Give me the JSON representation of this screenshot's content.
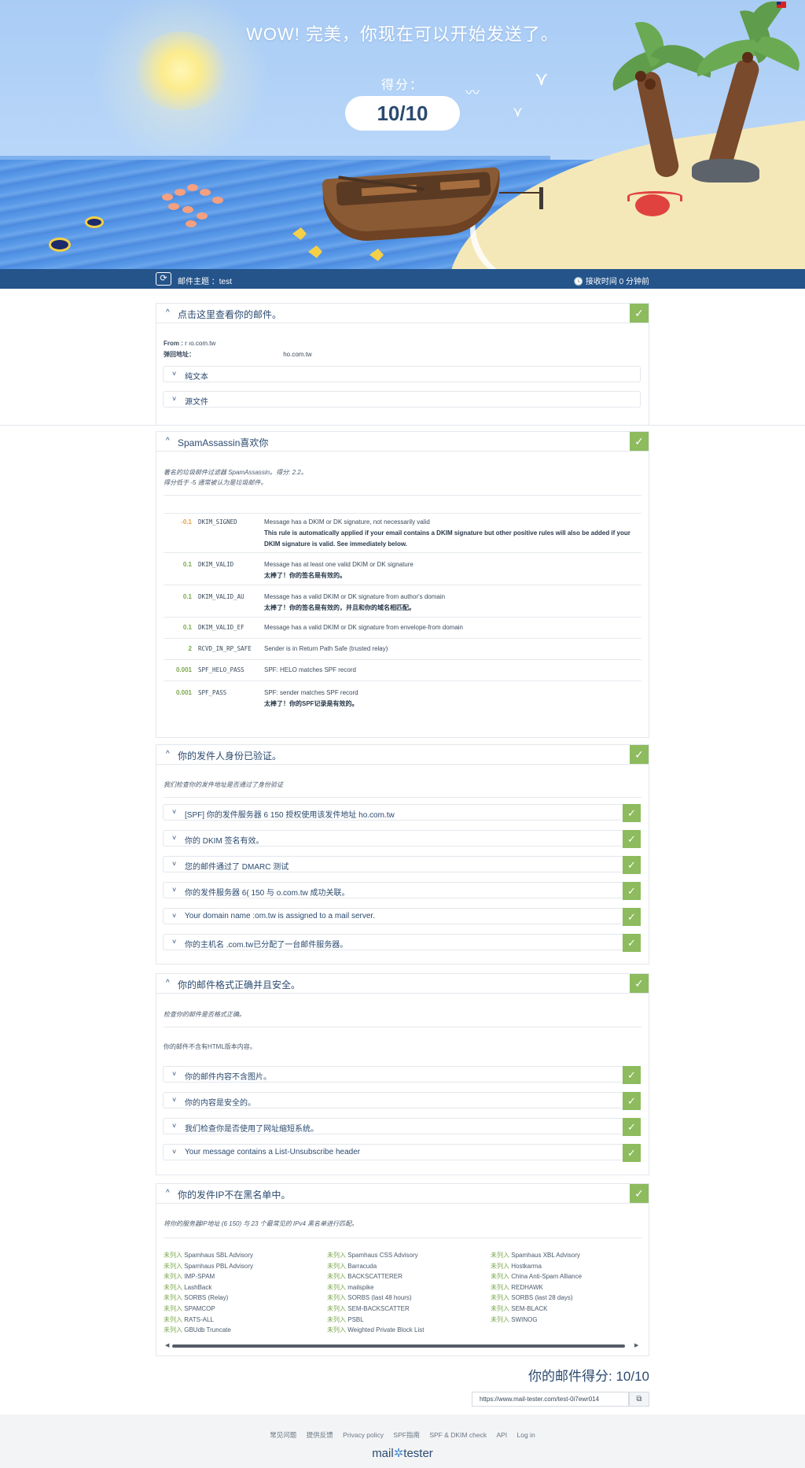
{
  "hero": {
    "title": "WOW! 完美，你现在可以开始发送了。",
    "score_label": "得分：",
    "score": "10/10"
  },
  "subject_bar": {
    "subject_label": "邮件主题 ：test",
    "receive_time": "接收时间 0 分钟前"
  },
  "email_panel": {
    "title": "点击这里查看你的邮件。",
    "from_label": "From :",
    "from_value": "r                              ıo.com.tw",
    "bounce_label": "弹回地址：",
    "bounce_value": "ho.com.tw",
    "sub_items": [
      "纯文本",
      "源文件"
    ]
  },
  "spam_panel": {
    "title": "SpamAssassin喜欢你",
    "note_line1": "著名的垃圾邮件过滤器 SpamAssassin。得分: 2.2。",
    "note_line2": "得分低于 -5 通常被认为是垃圾邮件。",
    "rows": [
      {
        "score": "-0.1",
        "code": "DKIM_SIGNED",
        "desc": "Message has a DKIM or DK signature, not necessarily valid",
        "extra": "This rule is automatically applied if your email contains a DKIM signature but other positive rules will also be added if your DKIM signature is valid. See immediately below.",
        "color": "#e8a040"
      },
      {
        "score": "0.1",
        "code": "DKIM_VALID",
        "desc": "Message has at least one valid DKIM or DK signature",
        "extra": "太棒了！你的签名是有效的。",
        "color": "#7aa84a"
      },
      {
        "score": "0.1",
        "code": "DKIM_VALID_AU",
        "desc": "Message has a valid DKIM or DK signature from author's domain",
        "extra": "太棒了！你的签名是有效的，并且和你的域名相匹配。",
        "color": "#7aa84a"
      },
      {
        "score": "0.1",
        "code": "DKIM_VALID_EF",
        "desc": "Message has a valid DKIM or DK signature from envelope-from domain",
        "extra": "",
        "color": "#7aa84a"
      },
      {
        "score": "2",
        "code": "RCVD_IN_RP_SAFE",
        "desc": "Sender is in Return Path Safe (trusted relay)",
        "extra": "",
        "color": "#7aa84a"
      },
      {
        "score": "0.001",
        "code": "SPF_HELO_PASS",
        "desc": "SPF: HELO matches SPF record",
        "extra": "",
        "color": "#7aa84a"
      },
      {
        "score": "0.001",
        "code": "SPF_PASS",
        "desc": "SPF: sender matches SPF record",
        "extra": "太棒了！你的SPF记录是有效的。",
        "color": "#7aa84a"
      }
    ]
  },
  "auth_panel": {
    "title": "你的发件人身份已验证。",
    "note": "我们检查你的发件地址是否通过了身份验证",
    "items": [
      "[SPF] 你的发件服务器 6                    150 授权使用该发件地址                                  ho.com.tw",
      "你的 DKIM 签名有效。",
      "您的邮件通过了 DMARC 测试",
      "你的发件服务器 6(            150 与             o.com.tw 成功关联。",
      "Your domain name            :om.tw is assigned to a mail server.",
      "你的主机名             .com.tw已分配了一台邮件服务器。"
    ]
  },
  "format_panel": {
    "title": "你的邮件格式正确并且安全。",
    "note": "检查你的邮件是否格式正确。",
    "note2": "你的邮件不含有HTML版本内容。",
    "items": [
      "你的邮件内容不含图片。",
      "你的内容是安全的。",
      "我们检查你是否使用了网址缩短系统。",
      "Your message contains a List-Unsubscribe header"
    ]
  },
  "blacklist_panel": {
    "title": "你的发件IP不在黑名单中。",
    "note": "将你的服务器IP地址 (6                150) 与 23 个最常见的 IPv4 黑名单进行匹配。",
    "status": "未列入",
    "col1": [
      "Spamhaus SBL Advisory",
      "Spamhaus PBL Advisory",
      "IMP-SPAM",
      "LashBack",
      "SORBS (Relay)",
      "SPAMCOP",
      "RATS-ALL",
      "GBUdb Truncate"
    ],
    "col2": [
      "Spamhaus CSS Advisory",
      "Barracuda",
      "BACKSCATTERER",
      "mailspike",
      "SORBS (last 48 hours)",
      "SEM-BACKSCATTER",
      "PSBL",
      "Weighted Private Block List"
    ],
    "col3": [
      "Spamhaus XBL Advisory",
      "Hostkarma",
      "China Anti-Spam Alliance",
      "REDHAWK",
      "SORBS (last 28 days)",
      "SEM-BLACK",
      "SWINOG"
    ]
  },
  "result": {
    "final_score": "你的邮件得分: 10/10",
    "url": "https://www.mail-tester.com/test-0i7ewr014",
    "copy_icon": "copy-icon"
  },
  "footer": {
    "links": [
      "常见问题",
      "提供反馈",
      "Privacy policy",
      "SPF指南",
      "SPF & DKIM check",
      "API",
      "Log in"
    ],
    "brand_left": "mail",
    "brand_right": "tester"
  },
  "colors": {
    "bar": "#24548a",
    "check": "#8dbb5e",
    "sky": "#a9ccf5",
    "sea": "#4e8fe3"
  }
}
